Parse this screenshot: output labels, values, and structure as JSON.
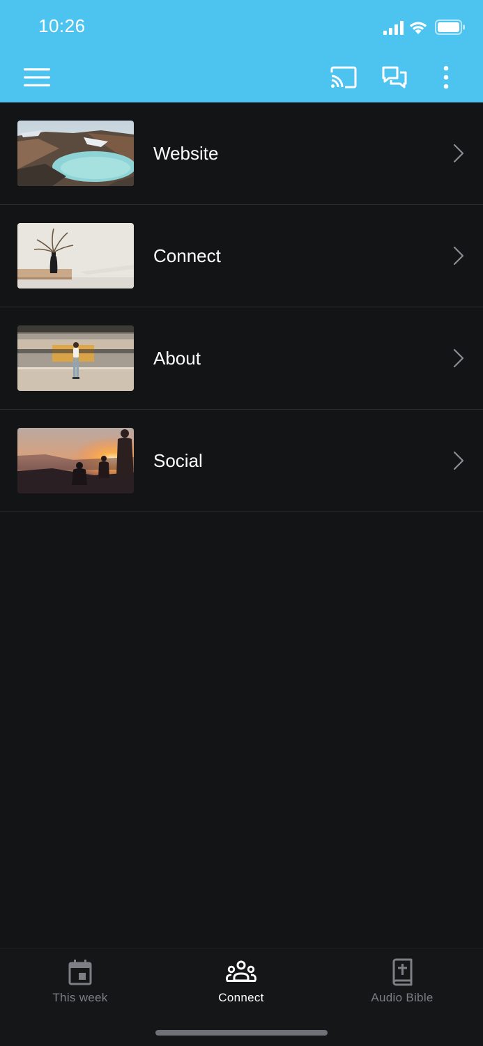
{
  "status_bar": {
    "time": "10:26",
    "icons": [
      "cellular-signal-icon",
      "wifi-icon",
      "battery-icon"
    ]
  },
  "toolbar": {
    "menu_icon": "hamburger-menu-icon",
    "cast_icon": "cast-icon",
    "chat_icon": "chat-icon",
    "more_icon": "more-vertical-icon",
    "background_color": "#4dc3f0"
  },
  "list": {
    "items": [
      {
        "label": "Website",
        "thumbnail": "crater-lake-landscape"
      },
      {
        "label": "Connect",
        "thumbnail": "vase-with-dried-plant"
      },
      {
        "label": "About",
        "thumbnail": "person-on-train-platform"
      },
      {
        "label": "Social",
        "thumbnail": "friends-at-sunset"
      }
    ]
  },
  "bottom_nav": {
    "tabs": [
      {
        "label": "This week",
        "icon": "calendar-icon",
        "active": false
      },
      {
        "label": "Connect",
        "icon": "people-group-icon",
        "active": true
      },
      {
        "label": "Audio Bible",
        "icon": "bible-icon",
        "active": false
      }
    ]
  },
  "colors": {
    "background": "#131416",
    "accent": "#4dc3f0",
    "inactive_tab": "#7d7f84"
  }
}
